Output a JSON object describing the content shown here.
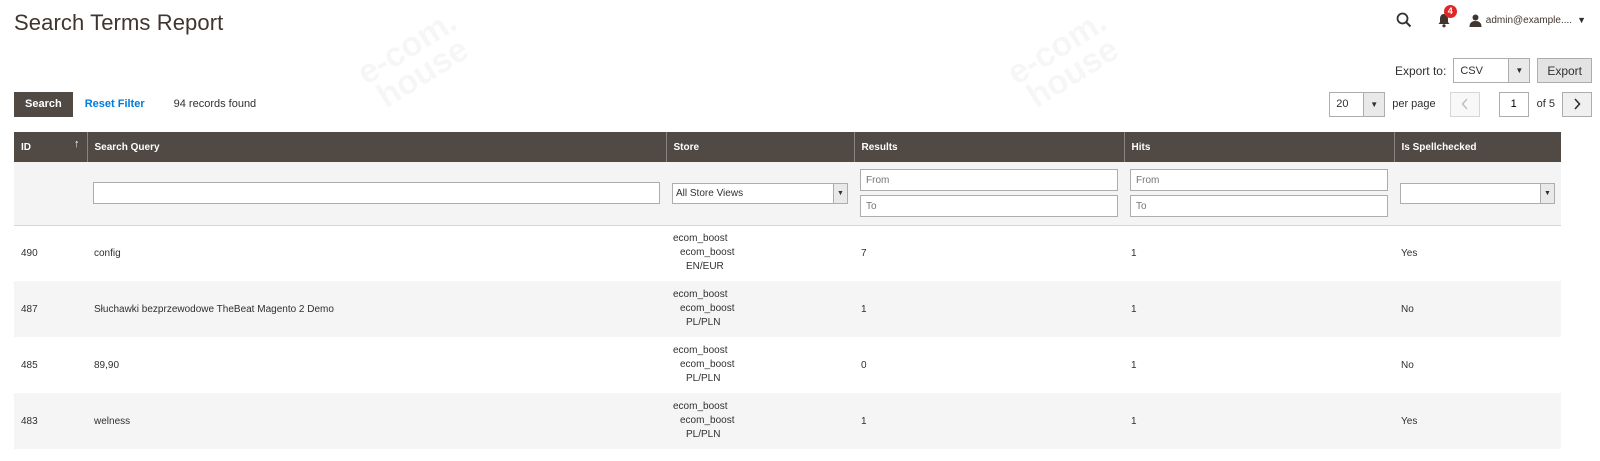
{
  "page": {
    "title": "Search Terms Report"
  },
  "header": {
    "notification_count": "4",
    "user_name": "admin@example...."
  },
  "export": {
    "label": "Export to:",
    "format": "CSV",
    "button_label": "Export"
  },
  "toolbar": {
    "search_label": "Search",
    "reset_label": "Reset Filter",
    "records_found": "94 records found",
    "per_page_value": "20",
    "per_page_label": "per page",
    "current_page": "1",
    "total_pages_label": "of 5"
  },
  "columns": [
    {
      "label": "ID"
    },
    {
      "label": "Search Query"
    },
    {
      "label": "Store"
    },
    {
      "label": "Results"
    },
    {
      "label": "Hits"
    },
    {
      "label": "Is Spellchecked"
    }
  ],
  "filters": {
    "store_value": "All Store Views",
    "results_from_placeholder": "From",
    "results_to_placeholder": "To",
    "hits_from_placeholder": "From",
    "hits_to_placeholder": "To",
    "spellchecked_value": ""
  },
  "rows": [
    {
      "id": "490",
      "query": "config",
      "store": [
        "ecom_boost",
        "ecom_boost",
        "EN/EUR"
      ],
      "results": "7",
      "hits": "1",
      "spellchecked": "Yes"
    },
    {
      "id": "487",
      "query": "Słuchawki bezprzewodowe TheBeat Magento 2 Demo",
      "store": [
        "ecom_boost",
        "ecom_boost",
        "PL/PLN"
      ],
      "results": "1",
      "hits": "1",
      "spellchecked": "No"
    },
    {
      "id": "485",
      "query": "89,90",
      "store": [
        "ecom_boost",
        "ecom_boost",
        "PL/PLN"
      ],
      "results": "0",
      "hits": "1",
      "spellchecked": "No"
    },
    {
      "id": "483",
      "query": "welness",
      "store": [
        "ecom_boost",
        "ecom_boost",
        "PL/PLN"
      ],
      "results": "1",
      "hits": "1",
      "spellchecked": "Yes"
    }
  ],
  "watermark_text": "e-com house",
  "icons": {
    "search": "search-icon",
    "bell": "bell-icon",
    "user": "user-icon",
    "sort": "sort-arrow-icon"
  },
  "colors": {
    "header_bg": "#514943",
    "link": "#007bdb",
    "badge": "#e22626"
  }
}
